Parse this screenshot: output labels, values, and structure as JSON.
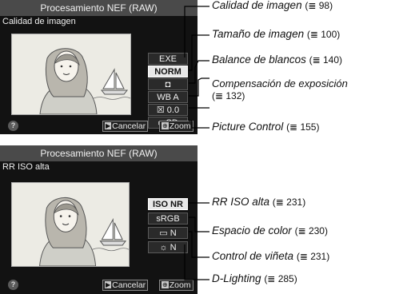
{
  "screen1": {
    "title": "Procesamiento NEF (RAW)",
    "subtitle": "Calidad de imagen",
    "options": [
      "EXE",
      "NORM",
      "◘",
      "WB A",
      "☒ 0.0",
      "▭SD"
    ],
    "buttons": {
      "cancel": "Cancelar",
      "zoom": "Zoom"
    },
    "help": "?"
  },
  "screen2": {
    "title": "Procesamiento NEF (RAW)",
    "subtitle": "RR ISO alta",
    "options": [
      "ISO NR N",
      "sRGB",
      "▭ N",
      "☼ N"
    ],
    "buttons": {
      "cancel": "Cancelar",
      "zoom": "Zoom"
    },
    "help": "?"
  },
  "callouts": [
    {
      "label": "Calidad de imagen",
      "ref": "(≣ 98)"
    },
    {
      "label": "Tamaño de imagen",
      "ref": "(≣ 100)"
    },
    {
      "label": "Balance de blancos",
      "ref": "(≣ 140)"
    },
    {
      "label": "Compensación de exposición",
      "ref": "(≣ 132)"
    },
    {
      "label": "Picture Control",
      "ref": "(≣ 155)"
    },
    {
      "label": "RR ISO alta",
      "ref": "(≣ 231)"
    },
    {
      "label": "Espacio de color",
      "ref": "(≣ 230)"
    },
    {
      "label": "Control de viñeta",
      "ref": "(≣ 231)"
    },
    {
      "label": "D-Lighting",
      "ref": "(≣ 285)"
    }
  ]
}
